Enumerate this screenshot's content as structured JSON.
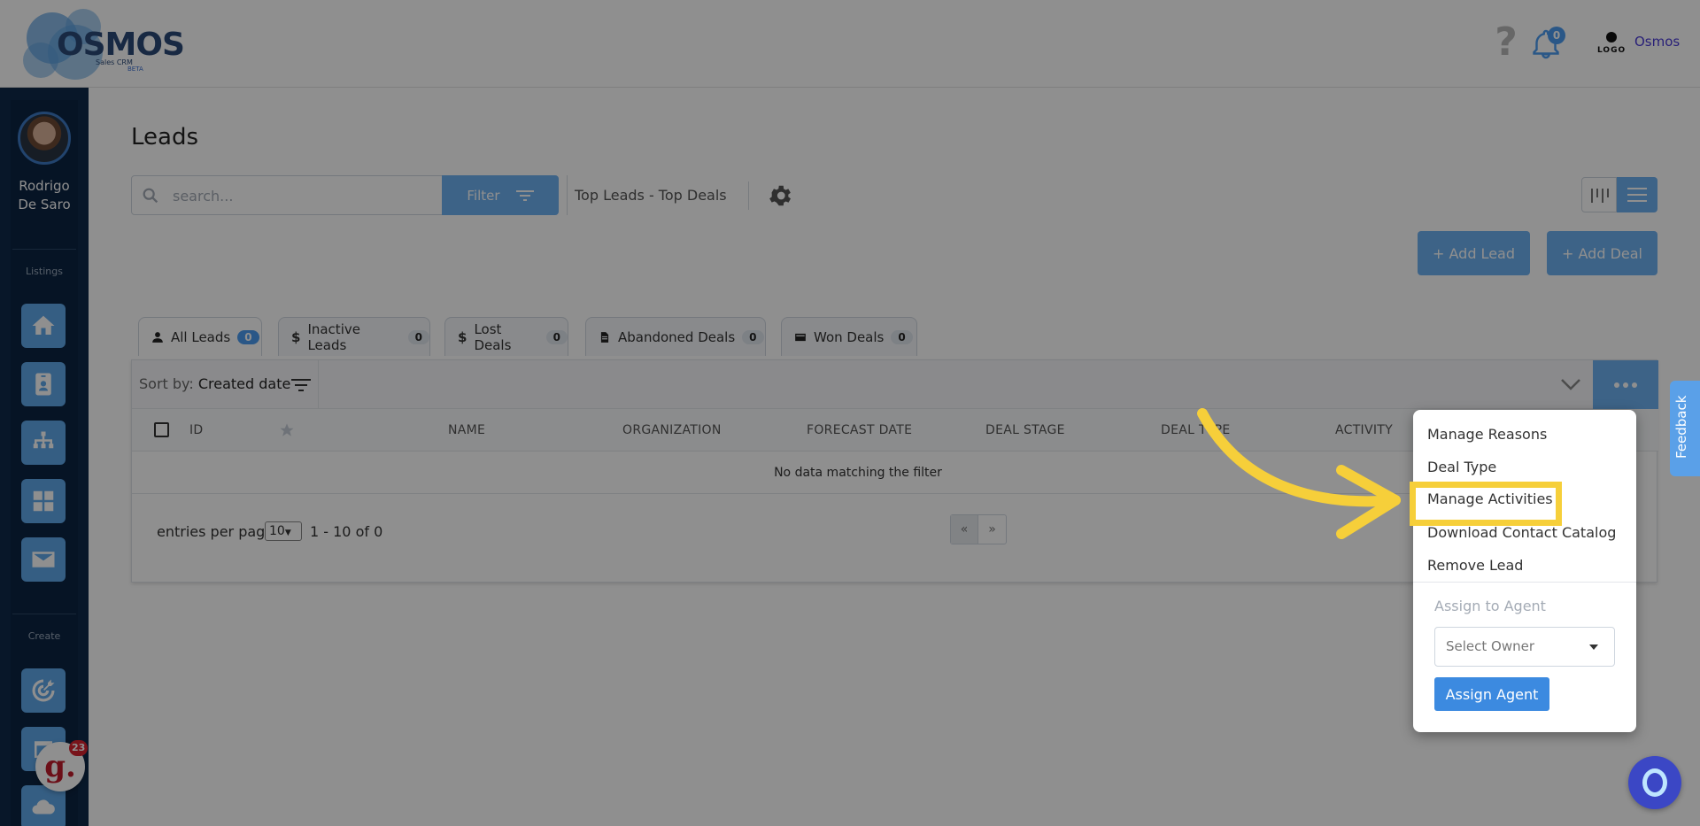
{
  "header": {
    "logo_text": "OSMOS",
    "logo_sub": "Sales CRM",
    "logo_beta": "BETA",
    "notification_count": "0",
    "user_logo_text": "LOGO",
    "user_name": "Osmos"
  },
  "sidebar": {
    "user_name_line1": "Rodrigo",
    "user_name_line2": "De Saro",
    "section_listings": "Listings",
    "section_create": "Create",
    "chat_badge": "23",
    "chat_letter": "g."
  },
  "main": {
    "title": "Leads",
    "search_placeholder": "search...",
    "filter_label": "Filter",
    "top_link": "Top Leads - Top Deals",
    "add_lead": "+ Add Lead",
    "add_deal": "+ Add Deal"
  },
  "tabs": [
    {
      "label": "All Leads",
      "count": "0",
      "icon": "user-icon"
    },
    {
      "label": "Inactive Leads",
      "count": "0",
      "icon": "dollar-icon"
    },
    {
      "label": "Lost Deals",
      "count": "0",
      "icon": "dollar-icon"
    },
    {
      "label": "Abandoned Deals",
      "count": "0",
      "icon": "document-icon"
    },
    {
      "label": "Won Deals",
      "count": "0",
      "icon": "card-icon"
    }
  ],
  "table": {
    "sort_label": "Sort by:",
    "sort_value": "Created date",
    "columns": [
      "ID",
      "NAME",
      "ORGANIZATION",
      "FORECAST DATE",
      "DEAL STAGE",
      "DEAL TYPE",
      "ACTIVITY"
    ],
    "empty_message": "No data matching the filter",
    "entries_label": "entries per page",
    "entries_value": "10",
    "range_label": "1 - 10 of 0",
    "pager_prev": "«",
    "pager_next": "»"
  },
  "dropdown": {
    "items": [
      "Manage Reasons",
      "Deal Type",
      "Manage Activities",
      "Download Contact Catalog",
      "Remove Lead"
    ],
    "section_label": "Assign to Agent",
    "select_placeholder": "Select Owner",
    "assign_button": "Assign Agent"
  },
  "feedback_label": "Feedback",
  "colors": {
    "accent": "#6eb0f0",
    "sidebar": "#0f2a4a",
    "highlight": "#f6cf3a"
  }
}
